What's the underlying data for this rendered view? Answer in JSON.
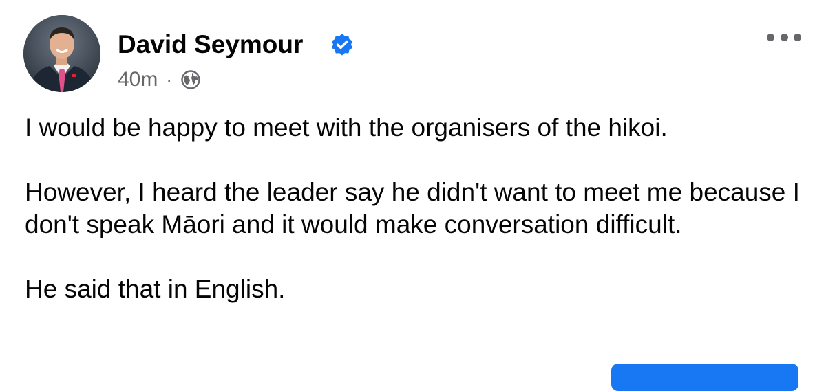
{
  "post": {
    "author": {
      "name": "David Seymour",
      "verified": true,
      "avatar_icon": "profile-photo"
    },
    "timestamp": "40m",
    "separator": "·",
    "audience_icon": "globe-icon",
    "more_icon": "more-options-icon",
    "body": [
      "I would be happy to meet with the organisers of the hikoi.",
      "However, I heard the leader say he didn't want to meet me because I don't speak Māori and it would make conversation difficult.",
      "He said that in English."
    ]
  },
  "colors": {
    "text_primary": "#050505",
    "text_secondary": "#65676b",
    "verified_badge": "#1877f2",
    "accent": "#1877f2",
    "background": "#ffffff"
  }
}
